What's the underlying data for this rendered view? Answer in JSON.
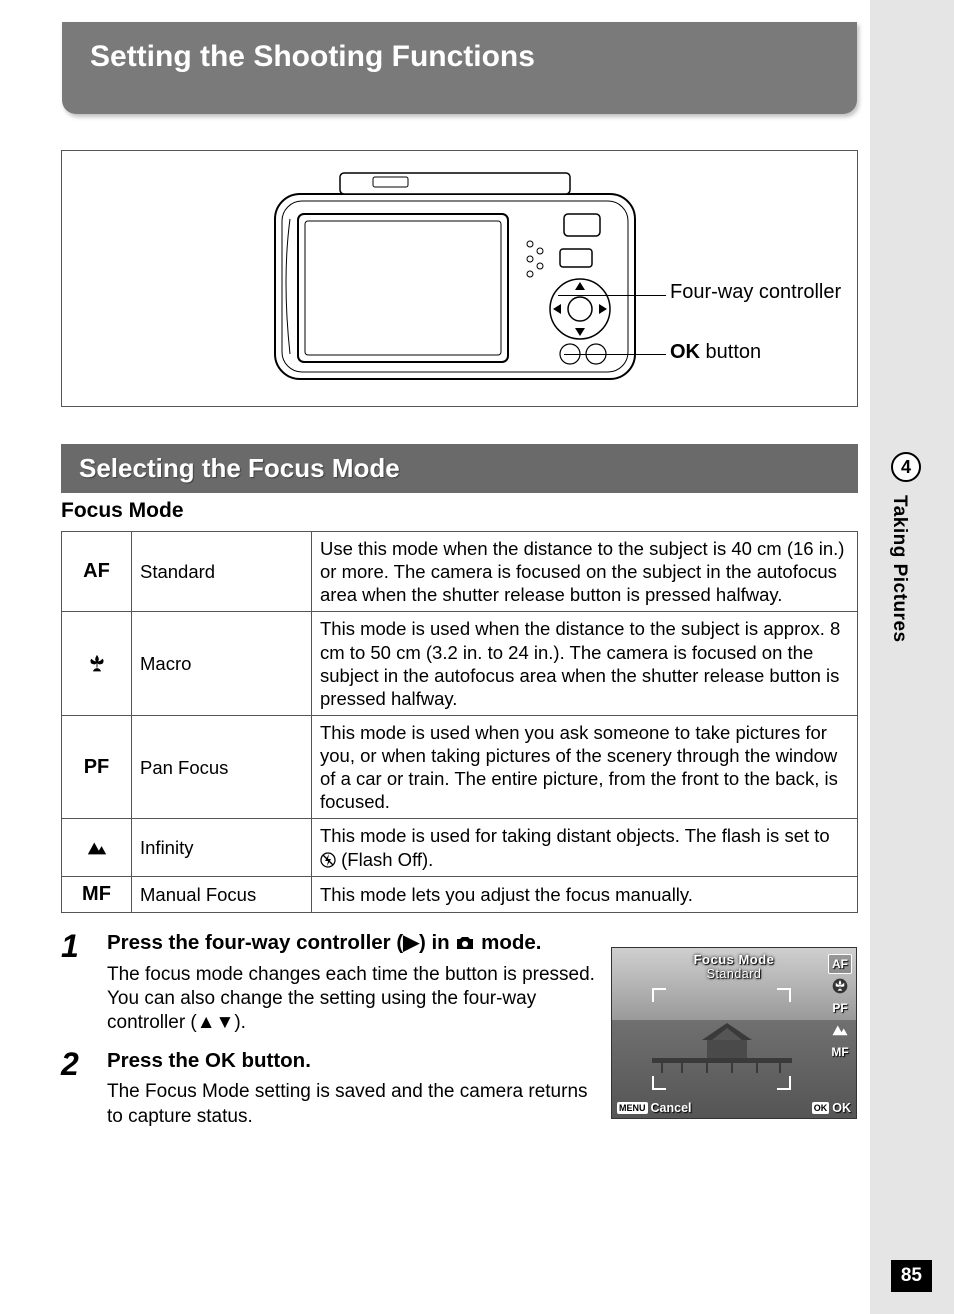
{
  "chapter": {
    "number": "4",
    "title": "Taking Pictures",
    "page": "85"
  },
  "title": "Setting the Shooting Functions",
  "diagram": {
    "callout1": "Four-way controller",
    "callout2_btn": "OK",
    "callout2_suffix": " button"
  },
  "section_header": "Selecting the Focus Mode",
  "subheading": "Focus Mode",
  "table": {
    "rows": [
      {
        "icon_text": "AF",
        "icon_type": "text",
        "name": "Standard",
        "desc": "Use this mode when the distance to the subject is 40 cm (16 in.) or more. The camera is focused on the subject in the autofocus area when the shutter release button is pressed halfway."
      },
      {
        "icon_text": "macro",
        "icon_type": "svg-macro",
        "name": "Macro",
        "desc": "This mode is used when the distance to the subject is approx. 8 cm to 50 cm (3.2 in. to 24 in.). The camera is focused on the subject in the autofocus area when the shutter release button is pressed halfway."
      },
      {
        "icon_text": "PF",
        "icon_type": "text",
        "name": "Pan Focus",
        "desc": "This mode is used when you ask someone to take pictures for you, or when taking pictures of the scenery through the window of a car or train. The entire picture, from the front to the back, is focused."
      },
      {
        "icon_text": "infinity",
        "icon_type": "svg-mountain",
        "name": "Infinity",
        "desc_prefix": "This mode is used for taking distant objects. The flash is set to ",
        "desc_suffix": " (Flash Off)."
      },
      {
        "icon_text": "MF",
        "icon_type": "text",
        "name": "Manual Focus",
        "desc": "This mode lets you adjust the focus manually."
      }
    ]
  },
  "steps": [
    {
      "num": "1",
      "title_prefix": "Press the four-way controller (",
      "title_mid": ") in ",
      "title_suffix": " mode.",
      "desc": "The focus mode changes each time the button is pressed. You can also change the setting using the four-way controller (▲▼)."
    },
    {
      "num": "2",
      "title_prefix": "Press the ",
      "title_btn": "OK",
      "title_suffix": " button.",
      "desc": "The Focus Mode setting is saved and the camera returns to capture status."
    }
  ],
  "lcd": {
    "title": "Focus Mode",
    "subtitle": "Standard",
    "modes": {
      "af": "AF",
      "macro": "macro-icon",
      "pf": "PF",
      "inf": "mountain-icon",
      "mf": "MF"
    },
    "footer": {
      "menu_badge": "MENU",
      "cancel": "Cancel",
      "ok_badge": "OK",
      "ok": "OK"
    }
  }
}
